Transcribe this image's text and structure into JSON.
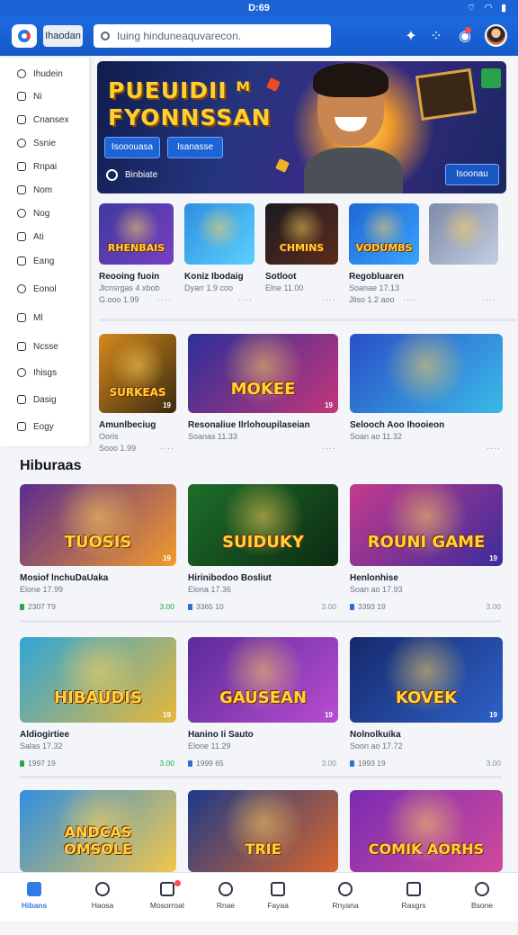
{
  "status": {
    "time": "D:69",
    "icons": "⌔ ◠ ▮"
  },
  "topbar": {
    "home_label": "Ihaodan",
    "search_value": "Iuing hinduneaquvarecon.",
    "icons": [
      "sparkle-icon",
      "grid-icon",
      "notification-icon"
    ]
  },
  "sidebar": {
    "items": [
      {
        "label": "Ihudein",
        "icon": "home-icon"
      },
      {
        "label": "Ni",
        "icon": "info-icon"
      },
      {
        "label": "Cnansex",
        "icon": "tag-icon"
      },
      {
        "label": "Ssnie",
        "icon": "chat-icon"
      },
      {
        "label": "Rnpai",
        "icon": "folder-icon"
      },
      {
        "label": "Nom",
        "icon": "user-icon"
      },
      {
        "label": "Nog",
        "icon": "gamepad-icon"
      },
      {
        "label": "Ati",
        "icon": "cloud-icon"
      },
      {
        "label": "Eang",
        "icon": "settings-icon"
      },
      {
        "label": "Eonol",
        "icon": "people-icon"
      },
      {
        "label": "Ml",
        "icon": "map-icon"
      },
      {
        "label": "Ncsse",
        "icon": "time-icon"
      },
      {
        "label": "Ihisgs",
        "icon": "card-icon"
      },
      {
        "label": "Dasig",
        "icon": "people-icon"
      },
      {
        "label": "Eogy",
        "icon": "power-icon"
      }
    ]
  },
  "hero": {
    "title_line1": "PUEUIDII ᴹ",
    "title_line2": "FYONNSSAN",
    "button1": "Isooouasa",
    "button2": "Isanasse",
    "footer_label": "Binbiate",
    "cta_label": "Isoonau"
  },
  "row1": [
    {
      "art": "RHENBAIS",
      "title": "Reooing fuoin",
      "sub": "Jlcnsrgas 4 xbob",
      "meta": "G.ooo 1.99",
      "dots": "····",
      "colors": [
        "#3c3b9e",
        "#7a3fc2"
      ]
    },
    {
      "art": "",
      "title": "Koniz Ibodaig",
      "sub": "Dyarr 1.9 coo",
      "meta": "",
      "dots": "····",
      "colors": [
        "#2e8fe0",
        "#5ad1ff"
      ]
    },
    {
      "art": "CHMINS",
      "title": "Sotloot",
      "sub": "Elne 11.00",
      "meta": "",
      "dots": "····",
      "colors": [
        "#1c1a22",
        "#5c2c1c"
      ]
    },
    {
      "art": "VODUMBS",
      "title": "Regobluaren",
      "sub": "Soanae 17.13",
      "meta": "Jliso 1.2 aoo",
      "dots": "····",
      "colors": [
        "#2067d4",
        "#39a3ff"
      ]
    },
    {
      "art": "",
      "title": "",
      "sub": "",
      "meta": "",
      "dots": "····",
      "colors": [
        "#7d8aa8",
        "#c5cee0"
      ]
    }
  ],
  "row2": [
    {
      "art": "SURKEAS",
      "badge": "19",
      "title": "Amunlbeciug",
      "sub": "Ooris",
      "meta": "Sooo 1.99",
      "dots": "····",
      "colors": [
        "#d68a1c",
        "#3a2a10"
      ]
    },
    {
      "art": "MOKEE",
      "badge": "19",
      "title": "Resonaliue Ilrlohoupilaseian",
      "sub": "Soanas 11.33",
      "meta": "",
      "dots": "····",
      "colors": [
        "#2c2f9a",
        "#c4367a"
      ]
    },
    {
      "art": "",
      "badge": "",
      "title": "Selooch Aoo Ihooieon",
      "sub": "Soan ao 11.32",
      "meta": "",
      "dots": "····",
      "colors": [
        "#2b4fc8",
        "#39b9e8"
      ]
    }
  ],
  "section_heading": "Hiburaas",
  "row3": [
    {
      "art": "TUOSIS",
      "badge": "19",
      "title": "Mosiof lnchuDaUaka",
      "sub": "Elone 17.99",
      "stat": "2307 T9",
      "rate": "3.00",
      "rate_grey": false,
      "icon_color": "#2aa84a",
      "colors": [
        "#5a2c8f",
        "#f29b2b"
      ]
    },
    {
      "art": "SUIDUKY",
      "badge": "",
      "title": "Hirinibodoo Bosliut",
      "sub": "Elona 17.36",
      "stat": "3365 10",
      "rate": "3.00",
      "rate_grey": true,
      "icon_color": "#2f6fd6",
      "colors": [
        "#1d6e2a",
        "#0d2a12"
      ]
    },
    {
      "art": "ROUNI GAME",
      "badge": "19",
      "title": "Henlonhise",
      "sub": "Soan ao 17.93",
      "stat": "3393 19",
      "rate": "3.00",
      "rate_grey": true,
      "icon_color": "#2f6fd6",
      "colors": [
        "#c43a8e",
        "#3b2c9a"
      ]
    }
  ],
  "row4": [
    {
      "art": "HIBAUDIS",
      "badge": "19",
      "title": "Aldiogirtiee",
      "sub": "Salas 17.32",
      "stat": "1997 19",
      "rate": "3.00",
      "rate_grey": false,
      "icon_color": "#2aa84a",
      "colors": [
        "#2fa6d8",
        "#e8b73a"
      ]
    },
    {
      "art": "GAUSEAN",
      "badge": "19",
      "title": "Hanino Ii Sauto",
      "sub": "Elone 11.29",
      "stat": "1999 65",
      "rate": "3.00",
      "rate_grey": true,
      "icon_color": "#2f6fd6",
      "colors": [
        "#5a2c9a",
        "#b94cd0"
      ]
    },
    {
      "art": "KOVEK",
      "badge": "19",
      "title": "Nolnolkuika",
      "sub": "Soon ao 17.72",
      "stat": "1993 19",
      "rate": "3.00",
      "rate_grey": true,
      "icon_color": "#2f6fd6",
      "colors": [
        "#162a6c",
        "#2e61c8"
      ]
    }
  ],
  "row5": [
    {
      "art": "ANDCAS OMSOLE",
      "colors": [
        "#2f8fe0",
        "#f2c54a"
      ]
    },
    {
      "art": "TRIE",
      "colors": [
        "#1d3a8a",
        "#d6652a"
      ]
    },
    {
      "art": "COMIK AORHS",
      "colors": [
        "#7a2cb4",
        "#d04a9a"
      ]
    }
  ],
  "bottomnav": [
    {
      "label": "Hibans",
      "icon": "home-icon",
      "active": true
    },
    {
      "label": "Haosa",
      "icon": "search-icon",
      "active": false
    },
    {
      "label": "Mosorroat",
      "icon": "inbox-icon",
      "active": false,
      "dot": true
    },
    {
      "label": "Rnae",
      "icon": "compass-icon",
      "active": false
    },
    {
      "label": "Fayaa",
      "icon": "edit-icon",
      "active": false
    },
    {
      "label": "Rnyana",
      "icon": "camera-icon",
      "active": false
    },
    {
      "label": "Rasgrs",
      "icon": "clock-icon",
      "active": false
    },
    {
      "label": "Bsone",
      "icon": "profile-icon",
      "active": false
    }
  ]
}
